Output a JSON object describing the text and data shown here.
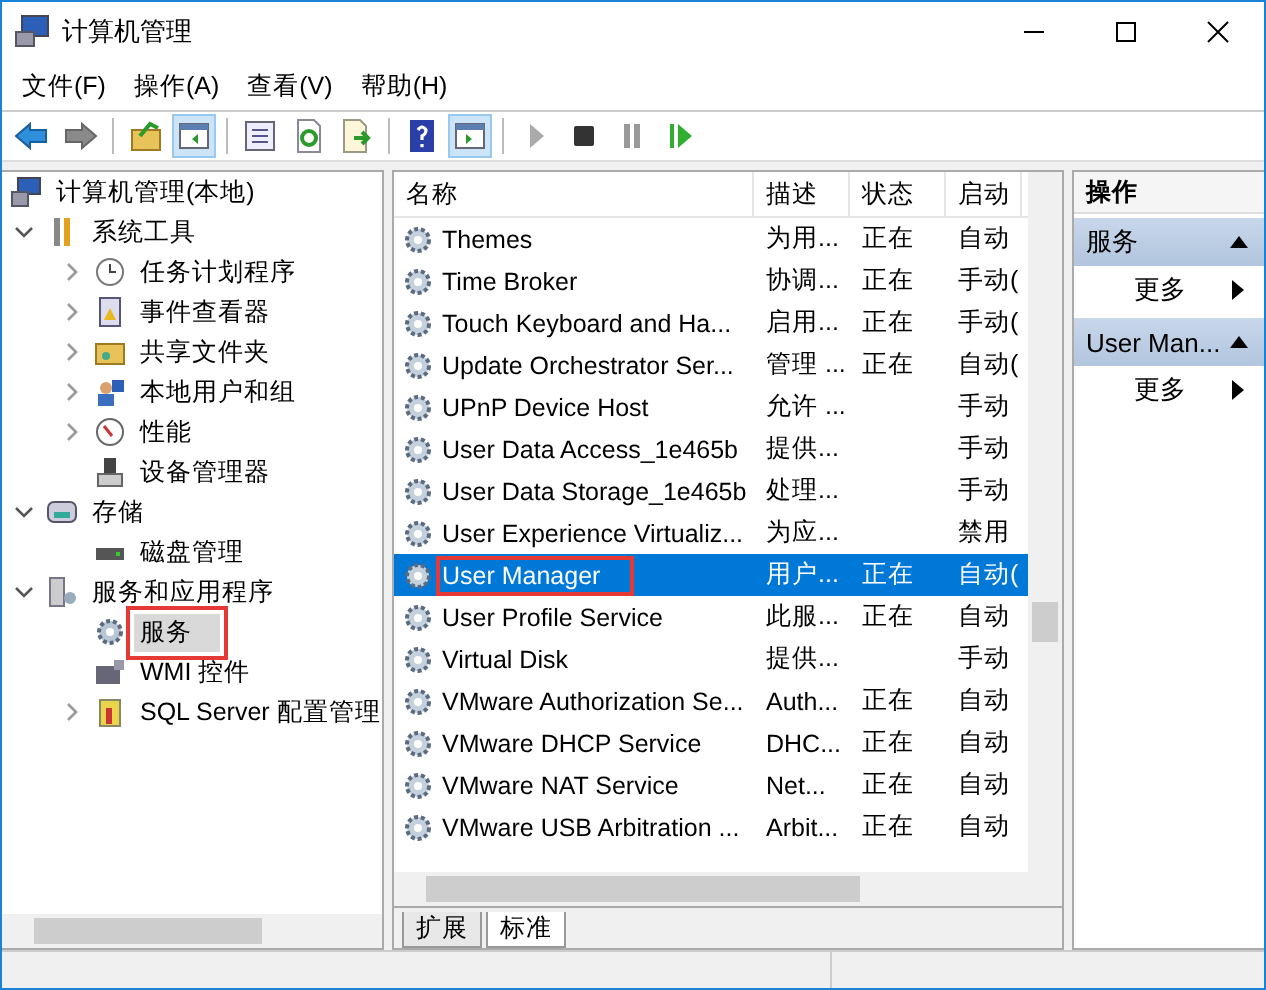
{
  "window": {
    "title": "计算机管理"
  },
  "menu": [
    "文件(F)",
    "操作(A)",
    "查看(V)",
    "帮助(H)"
  ],
  "toolbar": [
    {
      "kind": "back",
      "disabled": false,
      "pressed": false
    },
    {
      "kind": "forward",
      "disabled": true,
      "pressed": false
    },
    {
      "kind": "separator"
    },
    {
      "kind": "up",
      "pressed": false
    },
    {
      "kind": "tree",
      "pressed": true
    },
    {
      "kind": "separator"
    },
    {
      "kind": "properties",
      "pressed": false
    },
    {
      "kind": "refresh",
      "pressed": false
    },
    {
      "kind": "export",
      "pressed": false
    },
    {
      "kind": "separator"
    },
    {
      "kind": "help",
      "pressed": false
    },
    {
      "kind": "actionpane",
      "pressed": true
    },
    {
      "kind": "separator"
    },
    {
      "kind": "play",
      "disabled": true,
      "pressed": false
    },
    {
      "kind": "stop",
      "disabled": false,
      "pressed": false
    },
    {
      "kind": "pause",
      "disabled": true,
      "pressed": false
    },
    {
      "kind": "resume",
      "disabled": false,
      "pressed": false
    }
  ],
  "tree": [
    {
      "label": "计算机管理(本地)",
      "selected": false,
      "annotated": false,
      "children": [
        {
          "label": "系统工具",
          "expanded": true,
          "selected": false,
          "annotated": false,
          "children": [
            {
              "label": "任务计划程序",
              "expanded": false,
              "selected": false,
              "annotated": false
            },
            {
              "label": "事件查看器",
              "expanded": false,
              "selected": false,
              "annotated": false
            },
            {
              "label": "共享文件夹",
              "expanded": false,
              "selected": false,
              "annotated": false
            },
            {
              "label": "本地用户和组",
              "expanded": false,
              "selected": false,
              "annotated": false
            },
            {
              "label": "性能",
              "expanded": false,
              "selected": false,
              "annotated": false
            },
            {
              "label": "设备管理器",
              "selected": false,
              "annotated": false
            }
          ]
        },
        {
          "label": "存储",
          "expanded": true,
          "selected": false,
          "annotated": false,
          "children": [
            {
              "label": "磁盘管理",
              "selected": false,
              "annotated": false
            }
          ]
        },
        {
          "label": "服务和应用程序",
          "expanded": true,
          "selected": false,
          "annotated": false,
          "children": [
            {
              "label": "服务",
              "selected": true,
              "annotated": true
            },
            {
              "label": "WMI 控件",
              "selected": false,
              "annotated": false
            },
            {
              "label": "SQL Server 配置管理",
              "expanded": false,
              "selected": false,
              "annotated": false
            }
          ]
        }
      ]
    }
  ],
  "table": {
    "columns": [
      "名称",
      "描述",
      "状态",
      "启动"
    ],
    "rows": [
      {
        "cells": [
          "Themes",
          "为用...",
          "正在",
          "自动"
        ],
        "selected": false,
        "annotated": false
      },
      {
        "cells": [
          "Time Broker",
          "协调...",
          "正在",
          "手动("
        ],
        "selected": false,
        "annotated": false
      },
      {
        "cells": [
          "Touch Keyboard and Ha...",
          "启用...",
          "正在",
          "手动("
        ],
        "selected": false,
        "annotated": false
      },
      {
        "cells": [
          "Update Orchestrator Ser...",
          "管理 ...",
          "正在",
          "自动("
        ],
        "selected": false,
        "annotated": false
      },
      {
        "cells": [
          "UPnP Device Host",
          "允许 ...",
          "",
          "手动"
        ],
        "selected": false,
        "annotated": false
      },
      {
        "cells": [
          "User Data Access_1e465b",
          "提供...",
          "",
          "手动"
        ],
        "selected": false,
        "annotated": false
      },
      {
        "cells": [
          "User Data Storage_1e465b",
          "处理...",
          "",
          "手动"
        ],
        "selected": false,
        "annotated": false
      },
      {
        "cells": [
          "User Experience Virtualiz...",
          "为应...",
          "",
          "禁用"
        ],
        "selected": false,
        "annotated": false
      },
      {
        "cells": [
          "User Manager",
          "用户...",
          "正在",
          "自动("
        ],
        "selected": true,
        "annotated": true
      },
      {
        "cells": [
          "User Profile Service",
          "此服...",
          "正在",
          "自动"
        ],
        "selected": false,
        "annotated": false
      },
      {
        "cells": [
          "Virtual Disk",
          "提供...",
          "",
          "手动"
        ],
        "selected": false,
        "annotated": false
      },
      {
        "cells": [
          "VMware Authorization Se...",
          "Auth...",
          "正在",
          "自动"
        ],
        "selected": false,
        "annotated": false
      },
      {
        "cells": [
          "VMware DHCP Service",
          "DHC...",
          "正在",
          "自动"
        ],
        "selected": false,
        "annotated": false
      },
      {
        "cells": [
          "VMware NAT Service",
          "Net...",
          "正在",
          "自动"
        ],
        "selected": false,
        "annotated": false
      },
      {
        "cells": [
          "VMware USB Arbitration ...",
          "Arbit...",
          "正在",
          "自动"
        ],
        "selected": false,
        "annotated": false
      }
    ]
  },
  "view_tabs": [
    {
      "label": "扩展",
      "selected": false
    },
    {
      "label": "标准",
      "selected": true
    }
  ],
  "actions": {
    "title": "操作",
    "sections": [
      {
        "title": "服务",
        "items": [
          "更多"
        ]
      },
      {
        "title": "User Man...",
        "items": [
          "更多"
        ]
      }
    ]
  }
}
